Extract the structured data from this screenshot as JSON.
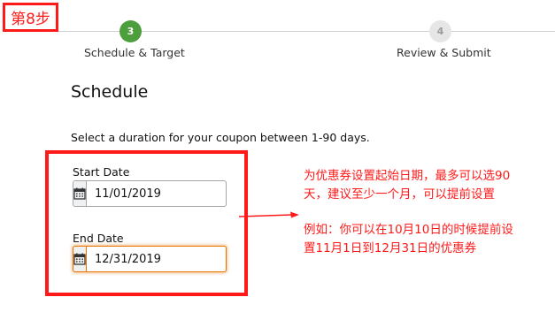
{
  "step_tag": {
    "label": "第8步"
  },
  "progress": {
    "steps": [
      {
        "number": "3",
        "label": "Schedule & Target",
        "state": "active"
      },
      {
        "number": "4",
        "label": "Review & Submit",
        "state": "pending"
      }
    ]
  },
  "schedule": {
    "title": "Schedule",
    "instruction": "Select a duration for your coupon between 1-90 days.",
    "start_date": {
      "label": "Start Date",
      "value": "11/01/2019",
      "icon": "calendar-icon"
    },
    "end_date": {
      "label": "End Date",
      "value": "12/31/2019",
      "icon": "calendar-icon",
      "focused": true
    }
  },
  "annotation": {
    "note1_line1": "为优惠券设置起始日期，最多可以选90",
    "note1_line2": "天，建议至少一个月，可以提前设置",
    "note2_line1": "例如：你可以在10月10日的时候提前设",
    "note2_line2": "置11月1日到12月31日的优惠券"
  },
  "colors": {
    "annotation_red": "#ff1a1a",
    "step_active": "#4d9e3c",
    "step_pending": "#e6e6e6",
    "focus_orange": "#e77600"
  }
}
